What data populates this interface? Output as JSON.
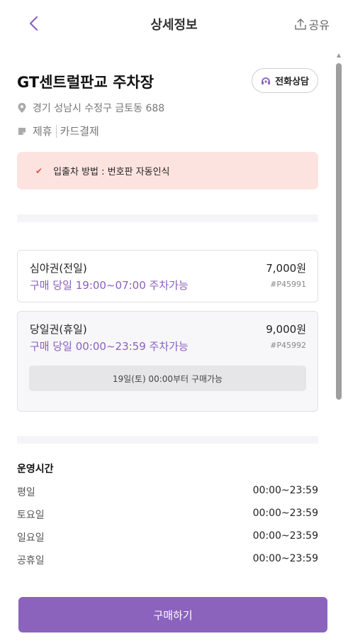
{
  "header": {
    "title": "상세정보",
    "share_label": "공유"
  },
  "lot": {
    "name": "GT센트럴판교 주차장",
    "call_label": "전화상담",
    "address": "경기 성남시 수정구 금토동 688",
    "tags": [
      "제휴",
      "카드결제"
    ],
    "notice": "입출차 방법 : 번호판 자동인식"
  },
  "tickets": [
    {
      "name": "심야권(전일)",
      "price": "7,000원",
      "time": "구매 당일 19:00~07:00 주차가능",
      "code": "#P45991"
    },
    {
      "name": "당일권(휴일)",
      "price": "9,000원",
      "time": "구매 당일 00:00~23:59 주차가능",
      "code": "#P45992",
      "availability": "19일(토) 00:00부터 구매가능"
    }
  ],
  "hours": {
    "title": "운영시간",
    "rows": [
      {
        "day": "평일",
        "time": "00:00~23:59"
      },
      {
        "day": "토요일",
        "time": "00:00~23:59"
      },
      {
        "day": "일요일",
        "time": "00:00~23:59"
      },
      {
        "day": "공휴일",
        "time": "00:00~23:59"
      }
    ]
  },
  "footer": {
    "buy_label": "구매하기"
  },
  "colors": {
    "accent": "#8b63bd",
    "notice_bg": "#fde3df",
    "check": "#d9534f"
  },
  "icons": {
    "back": "chevron-left-icon",
    "share": "share-upload-icon",
    "call": "headset-icon",
    "address": "location-pin-icon",
    "tag": "tag-icon",
    "notice": "check-icon"
  }
}
